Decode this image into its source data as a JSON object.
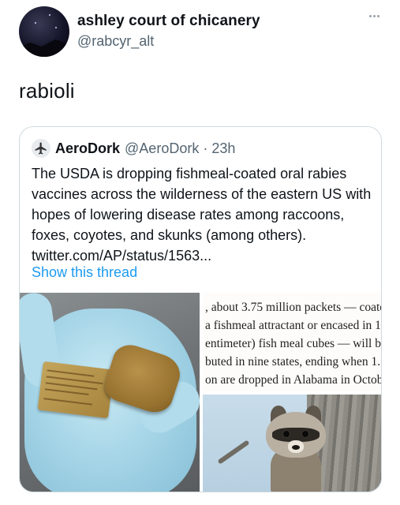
{
  "author": {
    "display_name": "ashley court of chicanery",
    "handle": "@rabcyr_alt"
  },
  "tweet": {
    "text": "rabioli"
  },
  "quoted_tweet": {
    "display_name": "AeroDork",
    "meta": "@AeroDork · 23h",
    "text": "The USDA is dropping fishmeal-coated oral rabies vaccines across the wilderness of the eastern US with hopes of lowering disease rates among raccoons, foxes, coyotes, and skunks (among others). twitter.com/AP/status/1563...",
    "show_thread": "Show this thread",
    "article_excerpt": [
      ", about 3.75 million packets — coate",
      "a fishmeal attractant or encased in 1",
      "entimeter) fish meal cubes — will b",
      "buted in nine states, ending when 1.",
      "on are dropped in Alabama in Octob"
    ]
  },
  "icons": {
    "more": "more-dots-icon",
    "quoted_avatar": "airplane-icon"
  },
  "colors": {
    "link": "#1d9bf0",
    "secondary_text": "#536471",
    "border": "#cfd9de"
  }
}
